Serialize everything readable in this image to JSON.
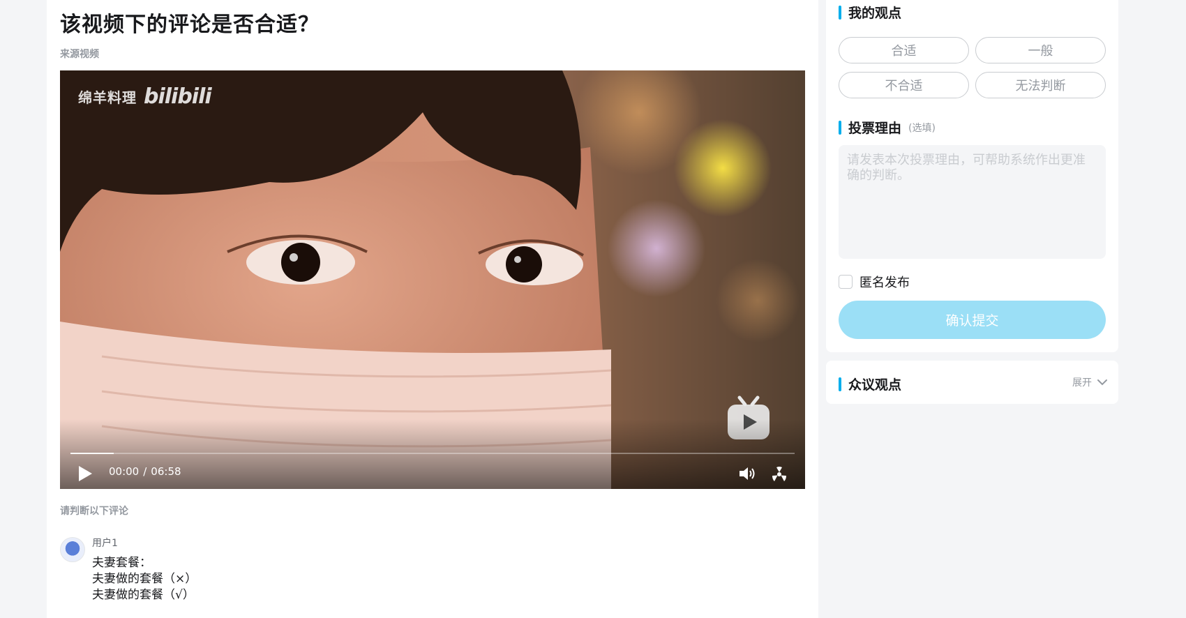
{
  "page": {
    "title": "该视频下的评论是否合适？",
    "source_label": "来源视频",
    "judge_label": "请判断以下评论"
  },
  "video": {
    "watermark_text": "绵羊料理",
    "watermark_logo": "bilibili",
    "current_time": "00:00",
    "time_separator": "/",
    "duration": "06:58",
    "progress": 0.06,
    "icons": [
      "play-icon",
      "volume-icon",
      "fullscreen-icon",
      "bilibili-tv-icon"
    ]
  },
  "comment": {
    "username": "用户1",
    "lines": [
      "夫妻套餐：",
      "夫妻做的套餐（×）",
      "夫妻做的套餐（√）"
    ]
  },
  "sidebar": {
    "my_view": {
      "heading": "我的观点",
      "options": [
        "合适",
        "一般",
        "不合适",
        "无法判断"
      ]
    },
    "reason": {
      "heading": "投票理由",
      "hint": "(选填)",
      "placeholder": "请发表本次投票理由，可帮助系统作出更准确的判断。"
    },
    "anonymous_label": "匿名发布",
    "submit_label": "确认提交",
    "public_view": {
      "heading": "众议观点",
      "expand_label": "展开"
    }
  },
  "colors": {
    "accent": "#00aeec",
    "submit_disabled": "#9bdff6",
    "background": "#f4f5f7"
  }
}
